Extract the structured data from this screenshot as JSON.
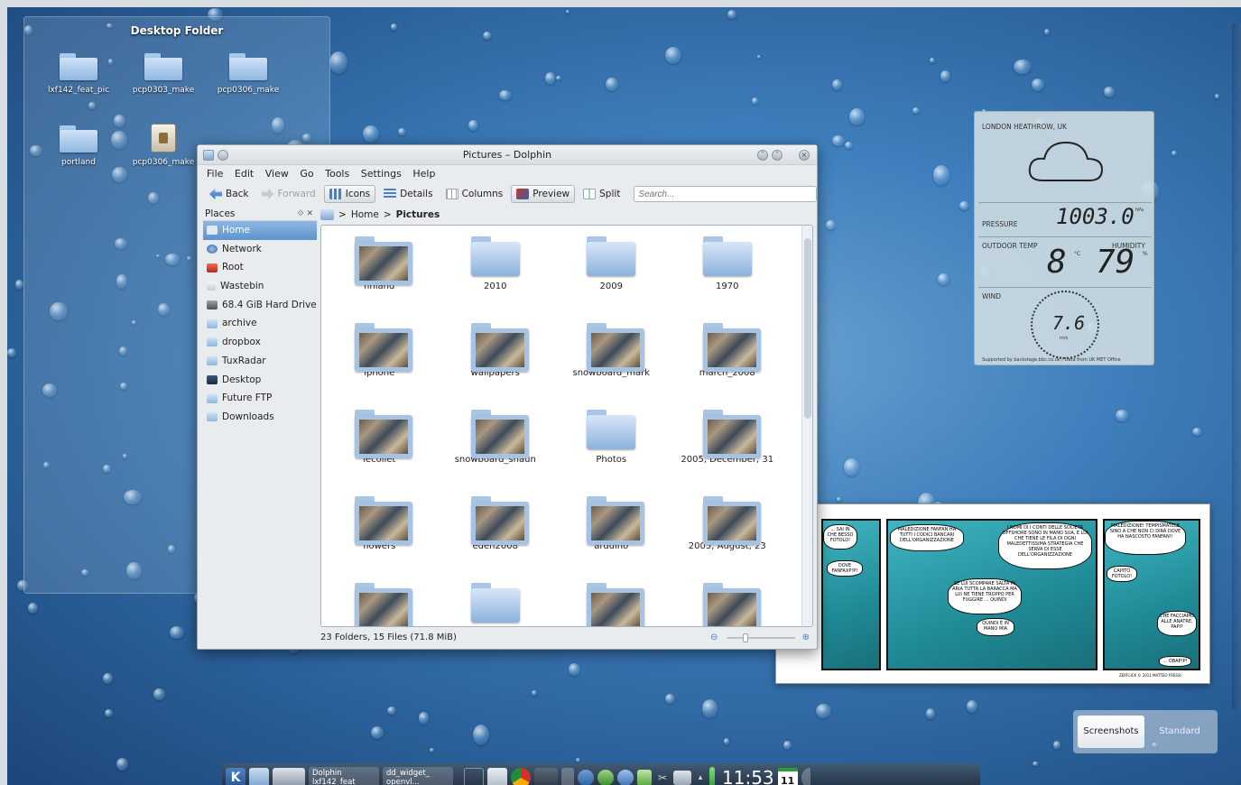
{
  "desktop_folder": {
    "title": "Desktop Folder",
    "items": [
      {
        "label": "lxf142_feat_pic",
        "type": "folder"
      },
      {
        "label": "pcp0303_make",
        "type": "folder"
      },
      {
        "label": "pcp0306_make",
        "type": "folder"
      },
      {
        "label": "portland",
        "type": "folder"
      },
      {
        "label": "pcp0306_make",
        "type": "package"
      }
    ]
  },
  "window": {
    "title": "Pictures – Dolphin",
    "menu": [
      "File",
      "Edit",
      "View",
      "Go",
      "Tools",
      "Settings",
      "Help"
    ],
    "toolbar": {
      "back": "Back",
      "forward": "Forward",
      "icons": "Icons",
      "details": "Details",
      "columns": "Columns",
      "preview": "Preview",
      "split": "Split",
      "search_placeholder": "Search..."
    },
    "places": {
      "header": "Places",
      "items": [
        "Home",
        "Network",
        "Root",
        "Wastebin",
        "68.4 GiB Hard Drive",
        "archive",
        "dropbox",
        "TuxRadar",
        "Desktop",
        "Future FTP",
        "Downloads"
      ],
      "selected": "Home"
    },
    "breadcrumb": [
      "Home",
      "Pictures"
    ],
    "files": [
      {
        "name": "finland",
        "thumbs": true
      },
      {
        "name": "2010",
        "thumbs": false
      },
      {
        "name": "2009",
        "thumbs": false
      },
      {
        "name": "1970",
        "thumbs": false
      },
      {
        "name": "iphone",
        "thumbs": true
      },
      {
        "name": "wallpapers",
        "thumbs": true
      },
      {
        "name": "snowboard_mark",
        "thumbs": true
      },
      {
        "name": "march_2008",
        "thumbs": true
      },
      {
        "name": "lecollet",
        "thumbs": true
      },
      {
        "name": "snowboard_shaun",
        "thumbs": true
      },
      {
        "name": "Photos",
        "thumbs": false
      },
      {
        "name": "2005, December, 31",
        "thumbs": true
      },
      {
        "name": "flowers",
        "thumbs": true
      },
      {
        "name": "eden2008",
        "thumbs": true
      },
      {
        "name": "arduino",
        "thumbs": true
      },
      {
        "name": "2005, August, 23",
        "thumbs": true
      },
      {
        "name": "",
        "thumbs": true
      },
      {
        "name": "",
        "thumbs": false
      },
      {
        "name": "",
        "thumbs": true
      },
      {
        "name": "",
        "thumbs": true
      }
    ],
    "status": "23 Folders, 15 Files (71.8 MiB)"
  },
  "weather": {
    "location": "LONDON HEATHROW, UK",
    "pressure_label": "PRESSURE",
    "pressure": "1003.0",
    "pressure_unit": "hPa",
    "outdoor_label": "OUTDOOR TEMP",
    "humidity_label": "HUMIDITY",
    "temp": "8",
    "temp_unit": "°C",
    "humidity": "79",
    "humidity_unit": "%",
    "wind_label": "WIND",
    "wind": "7.6",
    "wind_unit": "m/s",
    "footer": "Supported by backstage.bbc.co.uk / Data from UK MET Office"
  },
  "comic": {
    "bubbles": [
      "... SAI IN CHE BESSO FOTOLO!",
      "DOVE FANFAXP!P!",
      "MALEDIZIONE FANFAN HA TUTTI I CODICI BANCARI DELL'ORGANIZZAZIONE",
      "I NOMI DI I CONTI DELLE SOCIETÀ OFFSHORE SONO IN MANO SUA, E LUI CHE TIENE LE FILA DI OGNI MALEDETTISSIMA STRATEGIA CHE SERVA DI ESSE DELL'ORGANIZZAZIONE",
      "SE LUI SCOMPARE SALTA IN ARIA TUTTA LA BARACCA MA LUI NE TIENE TROPPO PER FUGGIRE ... QUINDI",
      "QUINDI È IN MANO MIA",
      "MALEDIZIONE! TEMPISMATELE SINO A CHE NON CI DIRÀ DOVE HA NASCOSTO FANFAN!!",
      "CAPITO FOTOLO!",
      "CHE FACCIAMO ALLE ANATRE, PAPI?",
      "... OBAP!P!",
      "ZERFLICK © 2011 MATTEO FRESSI"
    ]
  },
  "activity": {
    "active": "Screenshots",
    "inactive": "Standard"
  },
  "taskbar": {
    "tasks": [
      {
        "label": "Dolphin",
        "sub": "lxf142_feat"
      },
      {
        "label": "dd_widget_",
        "sub": "openvl..."
      }
    ],
    "clock": "11:53",
    "calendar_day": "11"
  }
}
